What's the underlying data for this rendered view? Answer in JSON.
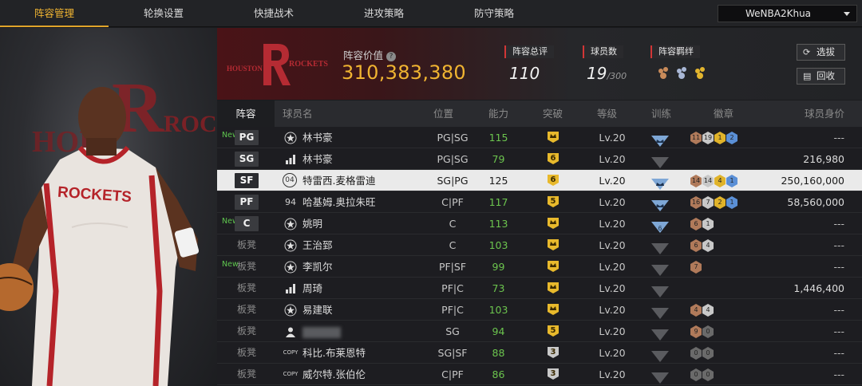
{
  "nav": {
    "tabs": [
      "阵容管理",
      "轮换设置",
      "快捷战术",
      "进攻策略",
      "防守策略"
    ],
    "active_tab": 0,
    "account": "WeNBA2Khua"
  },
  "header": {
    "logo_text_left": "HOUSTON",
    "logo_text_right": "ROCKETS",
    "value_label": "阵容价值",
    "help_icon": "?",
    "value": "310,383,380",
    "stats": [
      {
        "label": "阵容总评",
        "value": "110",
        "sub": ""
      },
      {
        "label": "球员数",
        "value": "19",
        "sub": "/300"
      },
      {
        "label": "阵容羁绊",
        "value": "",
        "sub": ""
      }
    ],
    "buttons": [
      {
        "label": "选拔",
        "icon": "refresh-icon"
      },
      {
        "label": "回收",
        "icon": "recycle-icon"
      }
    ]
  },
  "art": {
    "jersey_text": "ROCKETS",
    "bg_text": "ROCK"
  },
  "table": {
    "headers": [
      "阵容",
      "球员名",
      "位置",
      "能力",
      "突破",
      "等级",
      "训练",
      "徽章",
      "球员身价"
    ],
    "rows": [
      {
        "new": "New",
        "pos": "PG",
        "type": "star",
        "type_text": "",
        "name": "林书豪",
        "position": "PG|SG",
        "ability": "115",
        "breakthrough": "",
        "bk_color": "#e8b92c",
        "level": "Lv.20",
        "train": "blue",
        "badges": [
          [
            "11",
            "#b07a5a"
          ],
          [
            "19",
            "#c8c8c8"
          ],
          [
            "1",
            "#e0b32a"
          ],
          [
            "2",
            "#5a8fd6"
          ]
        ],
        "value": "---",
        "selected": false,
        "bench": false
      },
      {
        "new": "",
        "pos": "SG",
        "type": "bars",
        "type_text": "",
        "name": "林书豪",
        "position": "PG|SG",
        "ability": "79",
        "breakthrough": "6",
        "bk_color": "#e8b92c",
        "level": "Lv.20",
        "train": "gray",
        "badges": [],
        "value": "216,980",
        "selected": false,
        "bench": false
      },
      {
        "new": "",
        "pos": "SF",
        "type": "num",
        "type_text": "04",
        "name": "特雷西.麦格雷迪",
        "position": "SG|PG",
        "ability": "125",
        "breakthrough": "6",
        "bk_color": "#e8b92c",
        "level": "Lv.20",
        "train": "blue",
        "badges": [
          [
            "14",
            "#b07a5a"
          ],
          [
            "14",
            "#c8c8c8"
          ],
          [
            "4",
            "#e0b32a"
          ],
          [
            "1",
            "#5a8fd6"
          ]
        ],
        "value": "250,160,000",
        "selected": true,
        "bench": false
      },
      {
        "new": "",
        "pos": "PF",
        "type": "num",
        "type_text": "94",
        "name": "哈基姆.奥拉朱旺",
        "position": "C|PF",
        "ability": "117",
        "breakthrough": "5",
        "bk_color": "#e8b92c",
        "level": "Lv.20",
        "train": "blue",
        "badges": [
          [
            "16",
            "#b07a5a"
          ],
          [
            "7",
            "#c8c8c8"
          ],
          [
            "2",
            "#e0b32a"
          ],
          [
            "1",
            "#5a8fd6"
          ]
        ],
        "value": "58,560,000",
        "selected": false,
        "bench": false
      },
      {
        "new": "New",
        "pos": "C",
        "type": "star",
        "type_text": "",
        "name": "姚明",
        "position": "C",
        "ability": "113",
        "breakthrough": "",
        "bk_color": "#e8b92c",
        "level": "Lv.20",
        "train": "blue6",
        "badges": [
          [
            "6",
            "#b07a5a"
          ],
          [
            "1",
            "#c8c8c8"
          ]
        ],
        "value": "---",
        "selected": false,
        "bench": false
      },
      {
        "new": "",
        "pos": "板凳",
        "type": "star",
        "type_text": "",
        "name": "王治郅",
        "position": "C",
        "ability": "103",
        "breakthrough": "",
        "bk_color": "#e8b92c",
        "level": "Lv.20",
        "train": "gray",
        "badges": [
          [
            "6",
            "#b07a5a"
          ],
          [
            "4",
            "#c8c8c8"
          ]
        ],
        "value": "---",
        "selected": false,
        "bench": true
      },
      {
        "new": "New",
        "pos": "板凳",
        "type": "star",
        "type_text": "",
        "name": "李凯尔",
        "position": "PF|SF",
        "ability": "99",
        "breakthrough": "",
        "bk_color": "#e8b92c",
        "level": "Lv.20",
        "train": "gray",
        "badges": [
          [
            "7",
            "#b07a5a"
          ]
        ],
        "value": "---",
        "selected": false,
        "bench": true
      },
      {
        "new": "",
        "pos": "板凳",
        "type": "bars",
        "type_text": "",
        "name": "周琦",
        "position": "PF|C",
        "ability": "73",
        "breakthrough": "",
        "bk_color": "#e8b92c",
        "level": "Lv.20",
        "train": "gray",
        "badges": [],
        "value": "1,446,400",
        "selected": false,
        "bench": true
      },
      {
        "new": "",
        "pos": "板凳",
        "type": "star",
        "type_text": "",
        "name": "易建联",
        "position": "PF|C",
        "ability": "103",
        "breakthrough": "",
        "bk_color": "#e8b92c",
        "level": "Lv.20",
        "train": "gray",
        "badges": [
          [
            "4",
            "#b07a5a"
          ],
          [
            "4",
            "#c8c8c8"
          ]
        ],
        "value": "---",
        "selected": false,
        "bench": true
      },
      {
        "new": "",
        "pos": "板凳",
        "type": "person",
        "type_text": "",
        "name": "",
        "position": "SG",
        "ability": "94",
        "breakthrough": "5",
        "bk_color": "#e8b92c",
        "level": "Lv.20",
        "train": "gray",
        "badges": [
          [
            "9",
            "#b07a5a"
          ],
          [
            "0",
            "#6a6a6a"
          ]
        ],
        "value": "---",
        "selected": false,
        "bench": true
      },
      {
        "new": "",
        "pos": "板凳",
        "type": "copy",
        "type_text": "COPY",
        "name": "科比.布莱恩特",
        "position": "SG|SF",
        "ability": "88",
        "breakthrough": "3",
        "bk_color": "#c9c9c9",
        "level": "Lv.20",
        "train": "gray",
        "badges": [
          [
            "0",
            "#6a6a6a"
          ],
          [
            "0",
            "#6a6a6a"
          ]
        ],
        "value": "---",
        "selected": false,
        "bench": true
      },
      {
        "new": "",
        "pos": "板凳",
        "type": "copy",
        "type_text": "COPY",
        "name": "威尔特.张伯伦",
        "position": "C|PF",
        "ability": "86",
        "breakthrough": "3",
        "bk_color": "#c9c9c9",
        "level": "Lv.20",
        "train": "gray",
        "badges": [
          [
            "0",
            "#6a6a6a"
          ],
          [
            "0",
            "#6a6a6a"
          ]
        ],
        "value": "---",
        "selected": false,
        "bench": true
      }
    ]
  }
}
